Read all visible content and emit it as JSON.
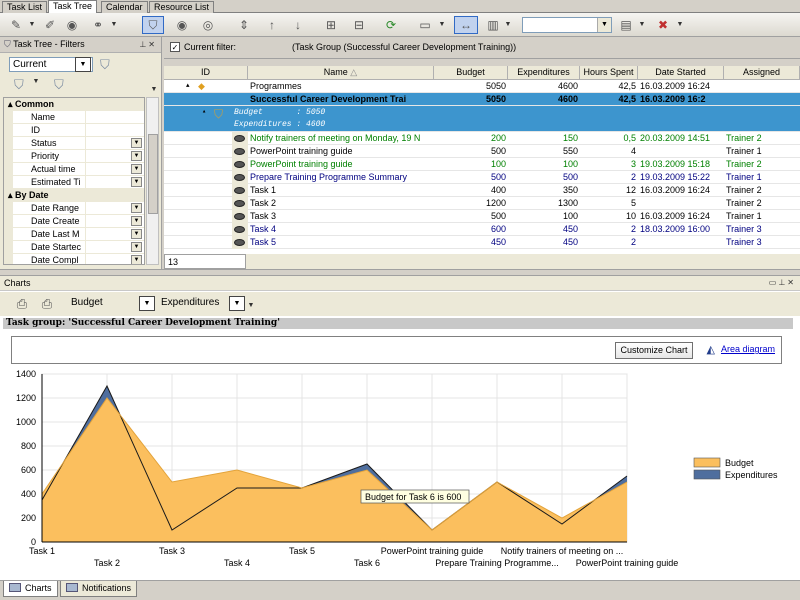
{
  "tabs": [
    "Task List",
    "Task Tree",
    "Calendar",
    "Resource List"
  ],
  "active_tab": 1,
  "toolbar": {
    "search_value": ""
  },
  "left_panel": {
    "title": "Task Tree - Filters",
    "filter_value": "Current",
    "categories": [
      {
        "name": "Common",
        "items": [
          {
            "label": "Name",
            "dropdown": false
          },
          {
            "label": "ID",
            "dropdown": false
          },
          {
            "label": "Status",
            "dropdown": true
          },
          {
            "label": "Priority",
            "dropdown": true
          },
          {
            "label": "Actual time",
            "dropdown": true
          },
          {
            "label": "Estimated Ti",
            "dropdown": true
          }
        ]
      },
      {
        "name": "By Date",
        "items": [
          {
            "label": "Date Range",
            "dropdown": true
          },
          {
            "label": "Date Create",
            "dropdown": true
          },
          {
            "label": "Date Last M",
            "dropdown": true
          },
          {
            "label": "Date Startec",
            "dropdown": true
          },
          {
            "label": "Date Compl",
            "dropdown": true
          }
        ]
      }
    ]
  },
  "filter_bar": {
    "checked": true,
    "label": "Current filter:",
    "expression": "(Task Group  (Successful Career Development Training))"
  },
  "grid": {
    "headers": [
      "ID",
      "Name",
      "Budget",
      "Expenditures",
      "Hours Spent",
      "Date Started",
      "Assigned"
    ],
    "programmes": {
      "name": "Programmes",
      "budget": "5050",
      "expenditures": "4600",
      "hours": "42,5",
      "date": "16.03.2009 16:24",
      "assigned": ""
    },
    "group": {
      "name": "Successful Career Development Trai",
      "budget": "5050",
      "expenditures": "4600",
      "hours": "42,5",
      "date": "16.03.2009 16:2",
      "assigned": ""
    },
    "group_summary": [
      "Budget       : 5050",
      "Expenditures : 4600"
    ],
    "rows": [
      {
        "name": "Notify trainers of meeting on Monday, 19 N",
        "budget": "200",
        "expenditures": "150",
        "hours": "0,5",
        "date": "20.03.2009 14:51",
        "assigned": "Trainer 2",
        "color": "green"
      },
      {
        "name": "PowerPoint training guide",
        "budget": "500",
        "expenditures": "550",
        "hours": "4",
        "date": "",
        "assigned": "Trainer 1",
        "color": "black"
      },
      {
        "name": "PowerPoint training guide",
        "budget": "100",
        "expenditures": "100",
        "hours": "3",
        "date": "19.03.2009 15:18",
        "assigned": "Trainer 2",
        "color": "green"
      },
      {
        "name": "Prepare Training Programme Summary",
        "budget": "500",
        "expenditures": "500",
        "hours": "2",
        "date": "19.03.2009 15:22",
        "assigned": "Trainer 1",
        "color": "blue"
      },
      {
        "name": "Task 1",
        "budget": "400",
        "expenditures": "350",
        "hours": "12",
        "date": "16.03.2009 16:24",
        "assigned": "Trainer 2",
        "color": "black"
      },
      {
        "name": "Task 2",
        "budget": "1200",
        "expenditures": "1300",
        "hours": "5",
        "date": "",
        "assigned": "Trainer 2",
        "color": "black"
      },
      {
        "name": "Task 3",
        "budget": "500",
        "expenditures": "100",
        "hours": "10",
        "date": "16.03.2009 16:24",
        "assigned": "Trainer 1",
        "color": "black"
      },
      {
        "name": "Task 4",
        "budget": "600",
        "expenditures": "450",
        "hours": "2",
        "date": "18.03.2009 16:00",
        "assigned": "Trainer 3",
        "color": "blue"
      },
      {
        "name": "Task 5",
        "budget": "450",
        "expenditures": "450",
        "hours": "2",
        "date": "",
        "assigned": "Trainer 3",
        "color": "blue"
      }
    ],
    "footer_count": "13"
  },
  "charts_panel": {
    "title": "Charts",
    "series1_select": "Budget",
    "series2_select": "Expenditures",
    "task_group_label": "Task group: 'Successful Career Development Training'",
    "customize_label": "Customize Chart",
    "area_link": "Area diagram"
  },
  "chart_data": {
    "type": "area",
    "categories": [
      "Task 1",
      "Task 2",
      "Task 3",
      "Task 4",
      "Task 5",
      "Task 6",
      "PowerPoint training guide",
      "Prepare Training Programme...",
      "Notify trainers of meeting on ...",
      "PowerPoint training guide"
    ],
    "series": [
      {
        "name": "Budget",
        "values": [
          400,
          1200,
          500,
          600,
          450,
          600,
          100,
          500,
          200,
          500
        ],
        "color": "#fbbf5e"
      },
      {
        "name": "Expenditures",
        "values": [
          350,
          1300,
          100,
          450,
          450,
          650,
          100,
          500,
          150,
          550
        ],
        "color": "#4f6e9e"
      }
    ],
    "ylim": [
      0,
      1400
    ],
    "yticks": [
      0,
      200,
      400,
      600,
      800,
      1000,
      1200,
      1400
    ],
    "grid": true,
    "legend": "right",
    "tooltip": "Budget for Task 6 is 600"
  },
  "bottom_tabs": [
    "Charts",
    "Notifications"
  ],
  "bottom_active": 0
}
